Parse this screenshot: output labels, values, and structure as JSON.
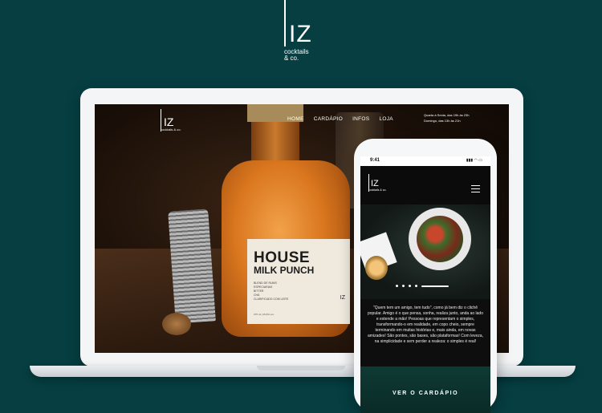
{
  "brand": {
    "logo_text": "IZ",
    "tagline_line1": "cocktails",
    "tagline_line2": "& co."
  },
  "desktop": {
    "logo_text": "IZ",
    "logo_sub": "cocktails & co.",
    "nav": [
      "HOME",
      "CARDÁPIO",
      "INFOS",
      "LOJA"
    ],
    "hours": [
      "Quarta à Sexta, das 19h às 23h",
      "Domingo, das 13h às 21h"
    ],
    "bottle_label": {
      "line1": "HOUSE",
      "line2": "MILK PUNCH",
      "details": [
        "BLEND DE RUMS",
        "ESPECIARIAS",
        "BITTER",
        "CHÁ",
        "CLARIFICADO COM LEITE"
      ],
      "mark": "IZ",
      "foot": "375 ml | 25,5% vol."
    }
  },
  "mobile": {
    "time": "9:41",
    "status_icons": "▮▮▮ ◠ ▭",
    "logo_text": "IZ",
    "logo_sub": "cocktails & co.",
    "carousel_slides": 5,
    "carousel_active_index": 4,
    "body_text": "\"Quem tem um amigo, tem tudo\", como já bem diz o clichê popular. Amigo é o que pensa, sonha, realiza junto, anda ao lado e estende a mão! Pessoas que representam o simples, transformando-o em realidade, em copo cheio, sempre terminando em muitas histórias e, mais ainda, em novas amizades! São pontes, são bases, são plataformas! Com leveza, na simplicidade e sem perder a realeza: o simples é real!",
    "cta_label": "VER O CARDÁPIO"
  },
  "colors": {
    "background": "#063e41",
    "device": "#f4f5f6"
  },
  "icons": {
    "menu": "hamburger-icon"
  }
}
